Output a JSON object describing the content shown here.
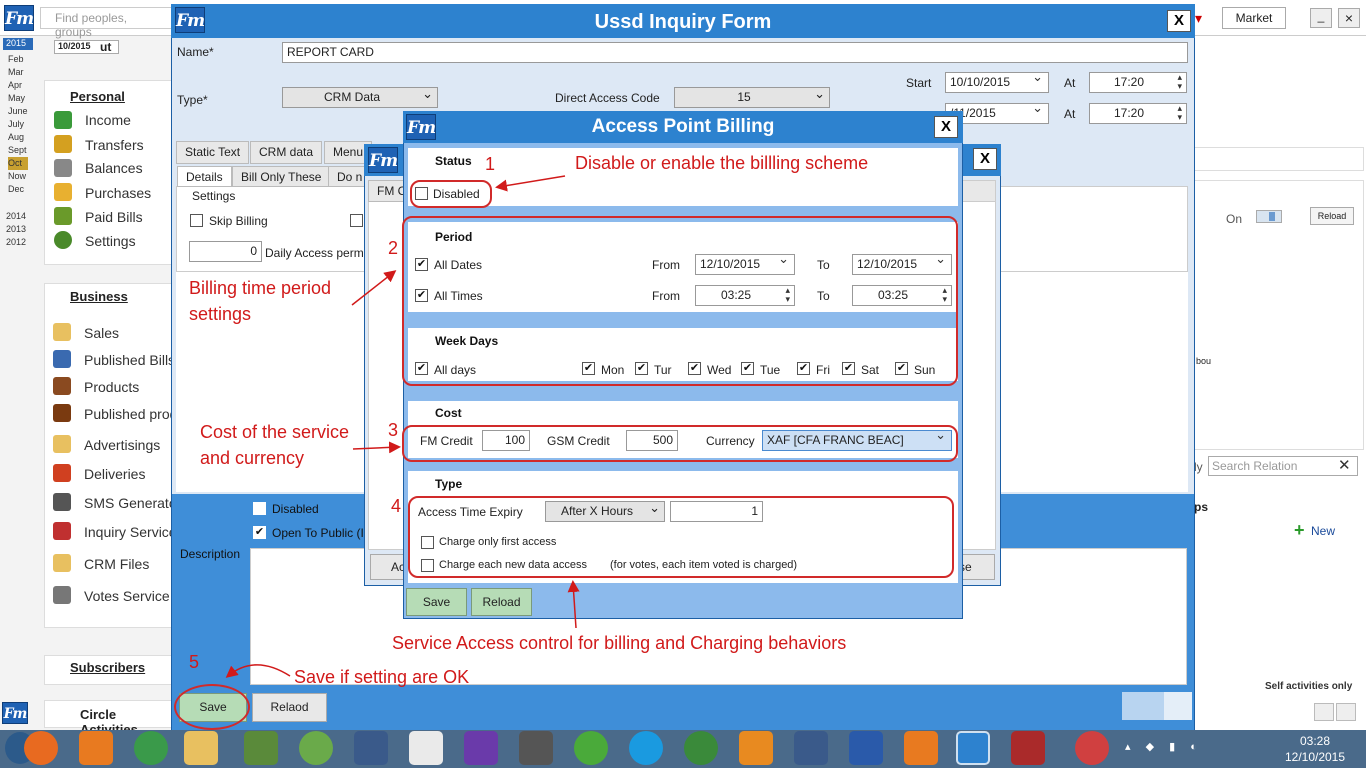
{
  "bg": {
    "search_placeholder": "Find peoples, groups",
    "market_label": "Market",
    "date_value": "10/2015",
    "year_top": "2015",
    "months": [
      "Feb",
      "Mar",
      "Apr",
      "May",
      "June",
      "July",
      "Aug",
      "Sept",
      "Oct",
      "Now",
      "Dec"
    ],
    "years": [
      "2014",
      "2013",
      "2012"
    ],
    "personal_title": "Personal",
    "personal_items": [
      "Income",
      "Transfers",
      "Balances",
      "Purchases",
      "Paid Bills",
      "Settings"
    ],
    "business_title": "Business",
    "business_items": [
      "Sales",
      "Published Bills",
      "Products",
      "Published prod",
      "Advertisings",
      "Deliveries",
      "SMS Generato",
      "Inquiry Service",
      "CRM Files",
      "Votes Service"
    ],
    "subscribers_title": "Subscribers",
    "circle_label": "Circle Activities",
    "on_label": "On",
    "reload_small": "Reload",
    "search_relation_placeholder": "Search Relation",
    "new_label": "New",
    "self_activities": "Self activities only",
    "bou": "bou",
    "ps": "ps",
    "ly": "ly"
  },
  "ussd": {
    "title": "Ussd Inquiry Form",
    "name_label": "Name*",
    "name_value": "REPORT CARD",
    "type_label": "Type*",
    "type_value": "CRM Data",
    "dac_label": "Direct Access Code",
    "dac_value": "15",
    "start_label": "Start",
    "start_date": "10/10/2015",
    "at_label": "At",
    "start_time": "17:20",
    "end_date": "/11/2015",
    "end_time": "17:20",
    "tabs": [
      "Static Text",
      "CRM data",
      "Menu"
    ],
    "subtabs": [
      "Details",
      "Bill Only These",
      "Do n"
    ],
    "settings_label": "Settings",
    "skip_billing": "Skip Billing",
    "daily_value": "0",
    "daily_label": "Daily Access permi",
    "disabled_label": "Disabled",
    "open_public": "Open To Public (I",
    "description_label": "Description",
    "save": "Save",
    "reload": "Relaod"
  },
  "mid": {
    "tab_label": "FM Cr",
    "btn_left": "Ac",
    "btn_right": "se"
  },
  "apb": {
    "title": "Access Point Billing",
    "status_title": "Status",
    "disabled_label": "Disabled",
    "period_title": "Period",
    "all_dates": "All Dates",
    "from_label": "From",
    "to_label": "To",
    "from_date": "12/10/2015",
    "to_date": "12/10/2015",
    "all_times": "All Times",
    "from_time": "03:25",
    "to_time": "03:25",
    "week_title": "Week Days",
    "all_days": "All days",
    "days": [
      "Mon",
      "Tur",
      "Wed",
      "Tue",
      "Fri",
      "Sat",
      "Sun"
    ],
    "cost_title": "Cost",
    "fm_credit_label": "FM Credit",
    "fm_credit_value": "100",
    "gsm_credit_label": "GSM Credit",
    "gsm_credit_value": "500",
    "currency_label": "Currency",
    "currency_value": "XAF  [CFA FRANC BEAC]",
    "type_title": "Type",
    "ate_label": "Access Time Expiry",
    "ate_value": "After X Hours",
    "ate_num": "1",
    "charge_first": "Charge only first access",
    "charge_each": "Charge each new data access",
    "charge_note": "(for votes, each item voted is charged)",
    "save": "Save",
    "reload": "Reload"
  },
  "ann": {
    "n1": "1",
    "t1": "Disable or enable the billling scheme",
    "n2": "2",
    "t2a": "Billing time period",
    "t2b": "settings",
    "n3": "3",
    "t3a": "Cost of the service",
    "t3b": "and currency",
    "n4": "4",
    "t4": "Service Access control for billing and Charging behaviors",
    "n5": "5",
    "t5": "Save if setting are OK"
  },
  "taskbar": {
    "time": "03:28",
    "date": "12/10/2015"
  }
}
